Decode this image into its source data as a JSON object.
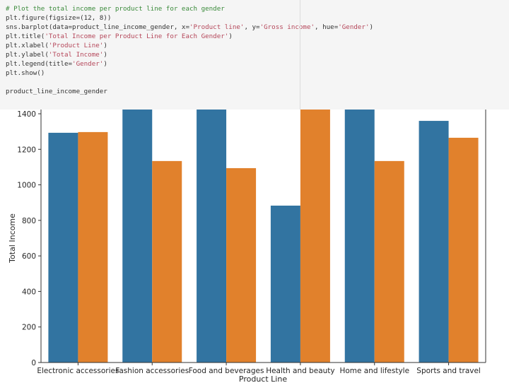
{
  "code_cell": {
    "lines": [
      [
        {
          "t": "# Plot the total income per product line for each gender",
          "c": "cm"
        }
      ],
      [
        {
          "t": "plt.figure(figsize=(12, 8))",
          "c": ""
        }
      ],
      [
        {
          "t": "sns.barplot(data=product_line_income_gender, x=",
          "c": ""
        },
        {
          "t": "'Product line'",
          "c": "st"
        },
        {
          "t": ", y=",
          "c": ""
        },
        {
          "t": "'Gross income'",
          "c": "st"
        },
        {
          "t": ", hue=",
          "c": ""
        },
        {
          "t": "'Gender'",
          "c": "st"
        },
        {
          "t": ")",
          "c": ""
        }
      ],
      [
        {
          "t": "plt.title(",
          "c": ""
        },
        {
          "t": "'Total Income per Product Line for Each Gender'",
          "c": "st"
        },
        {
          "t": ")",
          "c": ""
        }
      ],
      [
        {
          "t": "plt.xlabel(",
          "c": ""
        },
        {
          "t": "'Product Line'",
          "c": "st"
        },
        {
          "t": ")",
          "c": ""
        }
      ],
      [
        {
          "t": "plt.ylabel(",
          "c": ""
        },
        {
          "t": "'Total Income'",
          "c": "st"
        },
        {
          "t": ")",
          "c": ""
        }
      ],
      [
        {
          "t": "plt.legend(title=",
          "c": ""
        },
        {
          "t": "'Gender'",
          "c": "st"
        },
        {
          "t": ")",
          "c": ""
        }
      ],
      [
        {
          "t": "plt.show()",
          "c": ""
        }
      ],
      [
        {
          "t": "",
          "c": ""
        }
      ],
      [
        {
          "t": "product_line_income_gender",
          "c": ""
        }
      ]
    ]
  },
  "chart_data": {
    "type": "bar",
    "title": "",
    "xlabel": "Product Line",
    "ylabel": "Total Income",
    "categories": [
      "Electronic accessories",
      "Fashion accessories",
      "Food and beverages",
      "Health and beauty",
      "Home and lifestyle",
      "Sports and travel"
    ],
    "series": [
      {
        "color": "#3274a1",
        "values": [
          1293,
          null,
          null,
          883,
          null,
          1360
        ]
      },
      {
        "color": "#e1812c",
        "values": [
          1297,
          1134,
          1094,
          null,
          1134,
          1265
        ]
      }
    ],
    "clipped_above": 1425,
    "yticks": [
      0,
      200,
      400,
      600,
      800,
      1000,
      1200,
      1400
    ],
    "ylim": [
      0,
      1425
    ],
    "grid": false
  }
}
